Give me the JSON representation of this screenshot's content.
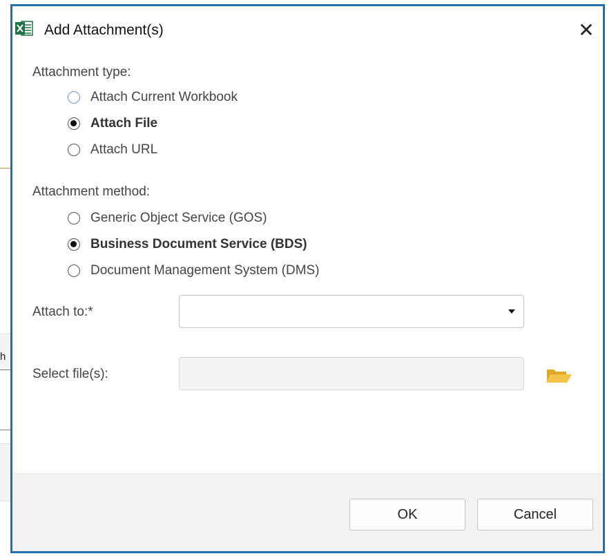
{
  "background": {
    "fragment_text": "h"
  },
  "dialog": {
    "title": "Add Attachment(s)",
    "app_icon": "excel-icon",
    "close_glyph": "✕",
    "attachment_type": {
      "label": "Attachment type:",
      "options": [
        {
          "label": "Attach Current Workbook",
          "selected": false,
          "focused": true
        },
        {
          "label": "Attach File",
          "selected": true
        },
        {
          "label": "Attach URL",
          "selected": false
        }
      ]
    },
    "attachment_method": {
      "label": "Attachment method:",
      "options": [
        {
          "label": "Generic Object Service (GOS)",
          "selected": false
        },
        {
          "label": "Business Document Service (BDS)",
          "selected": true
        },
        {
          "label": "Document Management System (DMS)",
          "selected": false
        }
      ]
    },
    "attach_to": {
      "label": "Attach to:*",
      "value": ""
    },
    "select_files": {
      "label": "Select file(s):",
      "value": "",
      "icon": "folder-open-icon"
    },
    "buttons": {
      "ok": "OK",
      "cancel": "Cancel"
    },
    "colors": {
      "border": "#1c6fb4",
      "excel_green": "#1e7145",
      "folder_yellow": "#f3c34a"
    }
  }
}
